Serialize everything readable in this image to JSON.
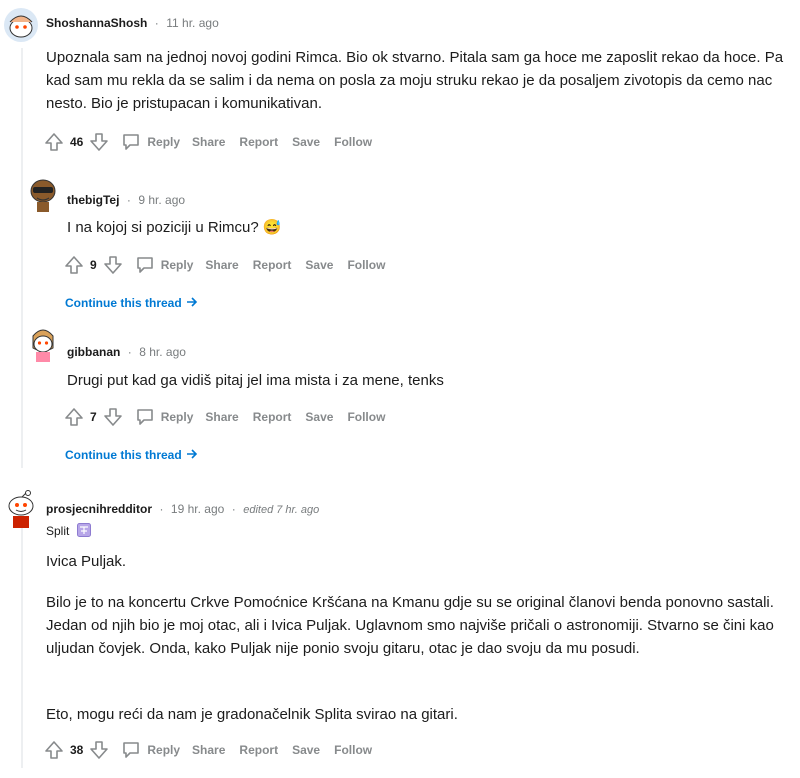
{
  "comments": [
    {
      "username": "ShoshannaShosh",
      "time": "11 hr. ago",
      "body": "Upoznala sam na jednoj novoj godini Rimca. Bio ok stvarno. Pitala sam ga hoce me zaposlit rekao da hoce. Pa kad sam mu rekla da se salim i da nema on posla za moju struku rekao je da posaljem zivotopis da cemo nac nesto. Bio je pristupacan i komunikativan.",
      "votes": "46"
    },
    {
      "username": "thebigTej",
      "time": "9 hr. ago",
      "body": "I na kojoj si poziciji u Rimcu? 😅",
      "votes": "9",
      "continue": "Continue this thread"
    },
    {
      "username": "gibbanan",
      "time": "8 hr. ago",
      "body": "Drugi put kad ga vidiš pitaj jel ima mista i za mene, tenks",
      "votes": "7",
      "continue": "Continue this thread"
    },
    {
      "username": "prosjecnihredditor",
      "time": "19 hr. ago",
      "edited": "edited 7 hr. ago",
      "flair": "Split",
      "p1": "Ivica Puljak.",
      "p2": "Bilo je to na koncertu Crkve Pomoćnice Kršćana na Kmanu gdje su se original članovi benda ponovno sastali. Jedan od njih bio je moj otac, ali i Ivica Puljak. Uglavnom smo najviše pričali o astronomiji. Stvarno se čini kao uljudan čovjek. Onda, kako Puljak nije ponio svoju gitaru, otac je dao svoju da mu posudi.",
      "p3": "Eto, mogu reći da nam je gradonačelnik Splita svirao na gitari.",
      "votes": "38"
    }
  ],
  "actions": {
    "reply": "Reply",
    "share": "Share",
    "report": "Report",
    "save": "Save",
    "follow": "Follow"
  },
  "separator": "·",
  "icons": {
    "upvote": "upvote-arrow-icon",
    "downvote": "downvote-arrow-icon",
    "reply": "speech-bubble-icon",
    "continue": "arrow-right-icon",
    "flair": "flair-emoji-icon"
  }
}
